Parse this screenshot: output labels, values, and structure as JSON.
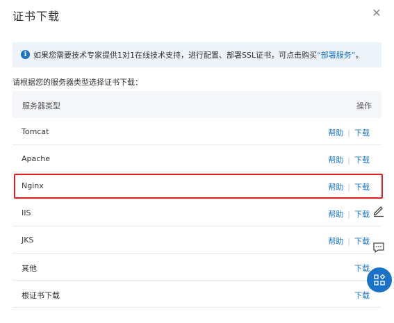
{
  "dialog": {
    "title": "证书下载"
  },
  "notice": {
    "text": "如果您需要技术专家提供1对1在线技术支持，进行配置、部署SSL证书，可点击购买",
    "link": "“部署服务”",
    "suffix": "。"
  },
  "subtitle": "请根据您的服务器类型选择证书下载：",
  "table": {
    "headers": {
      "server_type": "服务器类型",
      "action": "操作"
    },
    "help_label": "帮助",
    "separator": "|",
    "download_label": "下载",
    "rows": [
      {
        "name": "Tomcat"
      },
      {
        "name": "Apache"
      },
      {
        "name": "Nginx"
      },
      {
        "name": "IIS"
      },
      {
        "name": "JKS"
      },
      {
        "name": "其他"
      },
      {
        "name": "根证书下载"
      }
    ]
  },
  "colors": {
    "accent": "#1a73c7",
    "highlight": "#e02020",
    "notice_bg": "#eef3f9"
  },
  "icons": [
    "close-icon",
    "info-icon",
    "edit-icon",
    "chat-icon",
    "apps-icon"
  ]
}
